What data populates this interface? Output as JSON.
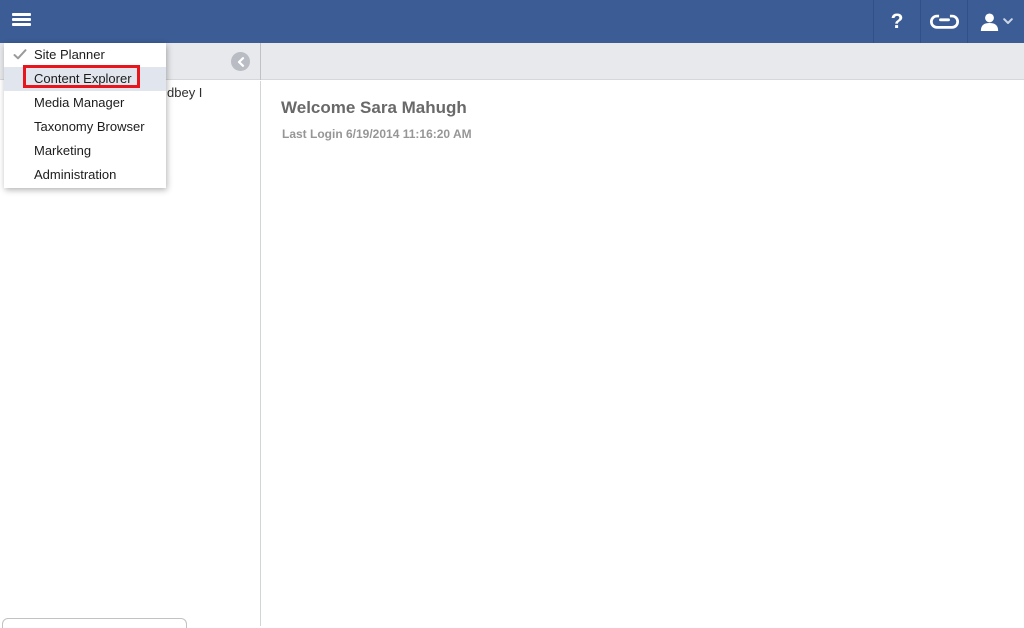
{
  "topbar": {
    "background_color": "#3b5c95",
    "help_label": "?",
    "icons": {
      "menu": "hamburger-icon",
      "help": "question-mark-glyph",
      "tray": "inbox-tray-icon",
      "user": "person-silhouette-icon",
      "user_chevron": "chevron-down-icon"
    }
  },
  "app_menu": {
    "checked_item": "Site Planner",
    "annotated_item": "Content Explorer",
    "annotation_color": "#e8161c",
    "items": [
      {
        "label": "Site Planner"
      },
      {
        "label": "Content Explorer"
      },
      {
        "label": "Media Manager"
      },
      {
        "label": "Taxonomy Browser"
      },
      {
        "label": "Marketing"
      },
      {
        "label": "Administration"
      }
    ]
  },
  "toolbar": {
    "back_icon": "chevron-left-circle-icon"
  },
  "sidebar": {
    "partial_item_text": "dbey I"
  },
  "main": {
    "welcome_heading": "Welcome Sara Mahugh",
    "last_login": "Last Login 6/19/2014 11:16:20 AM"
  }
}
